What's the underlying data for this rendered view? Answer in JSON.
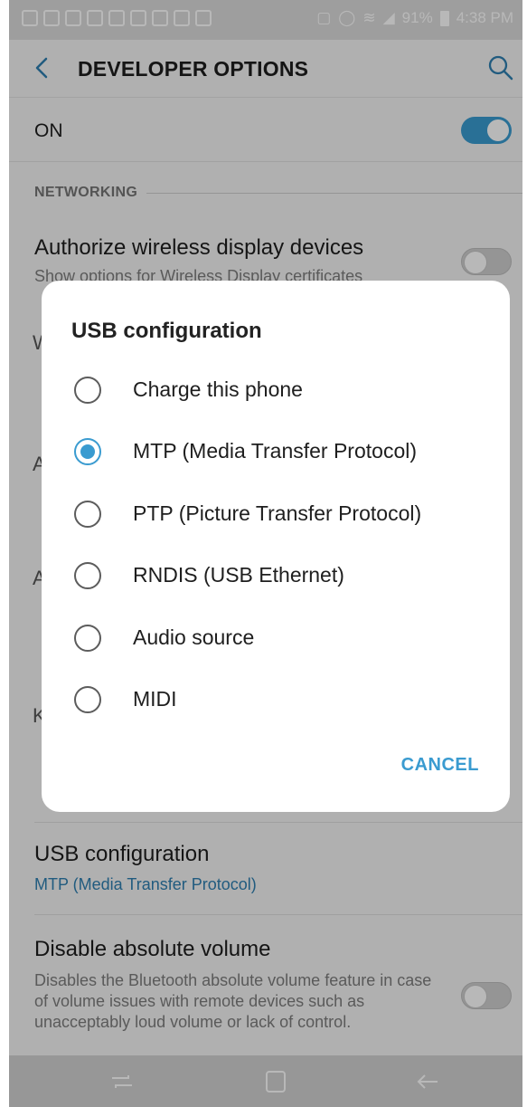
{
  "status_bar": {
    "battery": "91%",
    "time": "4:38 PM"
  },
  "header": {
    "title": "DEVELOPER OPTIONS"
  },
  "master_switch": {
    "label": "ON",
    "checked": true
  },
  "section": {
    "networking": "NETWORKING"
  },
  "settings": {
    "wireless_display": {
      "title": "Authorize wireless display devices",
      "subtitle": "Show options for Wireless Display certificates",
      "checked": false
    },
    "usb_configuration": {
      "title": "USB configuration",
      "value": "MTP (Media Transfer Protocol)"
    },
    "absolute_volume": {
      "title": "Disable absolute volume",
      "subtitle": "Disables the Bluetooth absolute volume feature in case of volume issues with remote devices such as unacceptably loud volume or lack of control.",
      "checked": false
    }
  },
  "dialog": {
    "title": "USB configuration",
    "options": [
      {
        "label": "Charge this phone",
        "selected": false
      },
      {
        "label": "MTP (Media Transfer Protocol)",
        "selected": true
      },
      {
        "label": "PTP (Picture Transfer Protocol)",
        "selected": false
      },
      {
        "label": "RNDIS (USB Ethernet)",
        "selected": false
      },
      {
        "label": "Audio source",
        "selected": false
      },
      {
        "label": "MIDI",
        "selected": false
      }
    ],
    "cancel_label": "CANCEL"
  },
  "colors": {
    "accent": "#3a9bd0",
    "link": "#2e7fb0"
  }
}
